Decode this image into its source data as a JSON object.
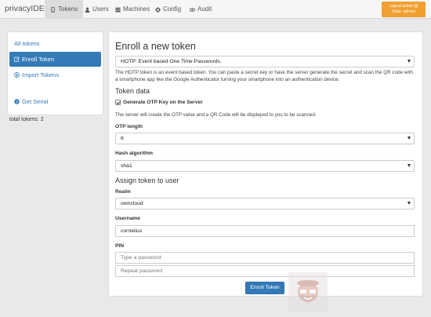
{
  "brand": "privacyIDEA",
  "nav": {
    "tabs": [
      {
        "label": "Tokens",
        "icon": "phone-icon"
      },
      {
        "label": "Users",
        "icon": "user-icon"
      },
      {
        "label": "Machines",
        "icon": "server-icon"
      },
      {
        "label": "Config",
        "icon": "gear-icon"
      },
      {
        "label": "Audit",
        "icon": "eye-icon"
      }
    ],
    "user": {
      "line1": "Logout admin @",
      "line2": "(Role: admin)"
    }
  },
  "sidebar": {
    "items": [
      {
        "label": "All tokens"
      },
      {
        "label": "Enroll Token"
      },
      {
        "label": "Import Tokens"
      },
      {
        "label": "Get Serial"
      }
    ],
    "total": "total tokens: 2"
  },
  "main": {
    "title": "Enroll a new token",
    "token_type": "HOTP: Event based One Time Passwords.",
    "description": "The HOTP token is an event based token. You can paste a secret key or have the server generate the secret and scan the QR code with a smartphone app like the Google Authenticator turning your smartphone into an authentication device.",
    "token_data_heading": "Token data",
    "genkey_label": "Generate OTP Key on the Server",
    "genkey_checked": true,
    "genkey_desc": "The server will create the OTP value and a QR Code will be displayed to you to be scanned.",
    "otp_length_label": "OTP length",
    "otp_length_value": "6",
    "hash_label": "Hash algorithm",
    "hash_value": "sha1",
    "assign_heading": "Assign token to user",
    "realm_label": "Realm",
    "realm_value": "owncloud",
    "username_label": "Username",
    "username_value": "cornelius",
    "pin_label": "PIN",
    "pin_placeholder": "Type a password",
    "pin_repeat_placeholder": "Repeat password",
    "enroll_button": "Enroll Token"
  },
  "colors": {
    "primary": "#337ab7",
    "user_box": "#f0a030"
  }
}
